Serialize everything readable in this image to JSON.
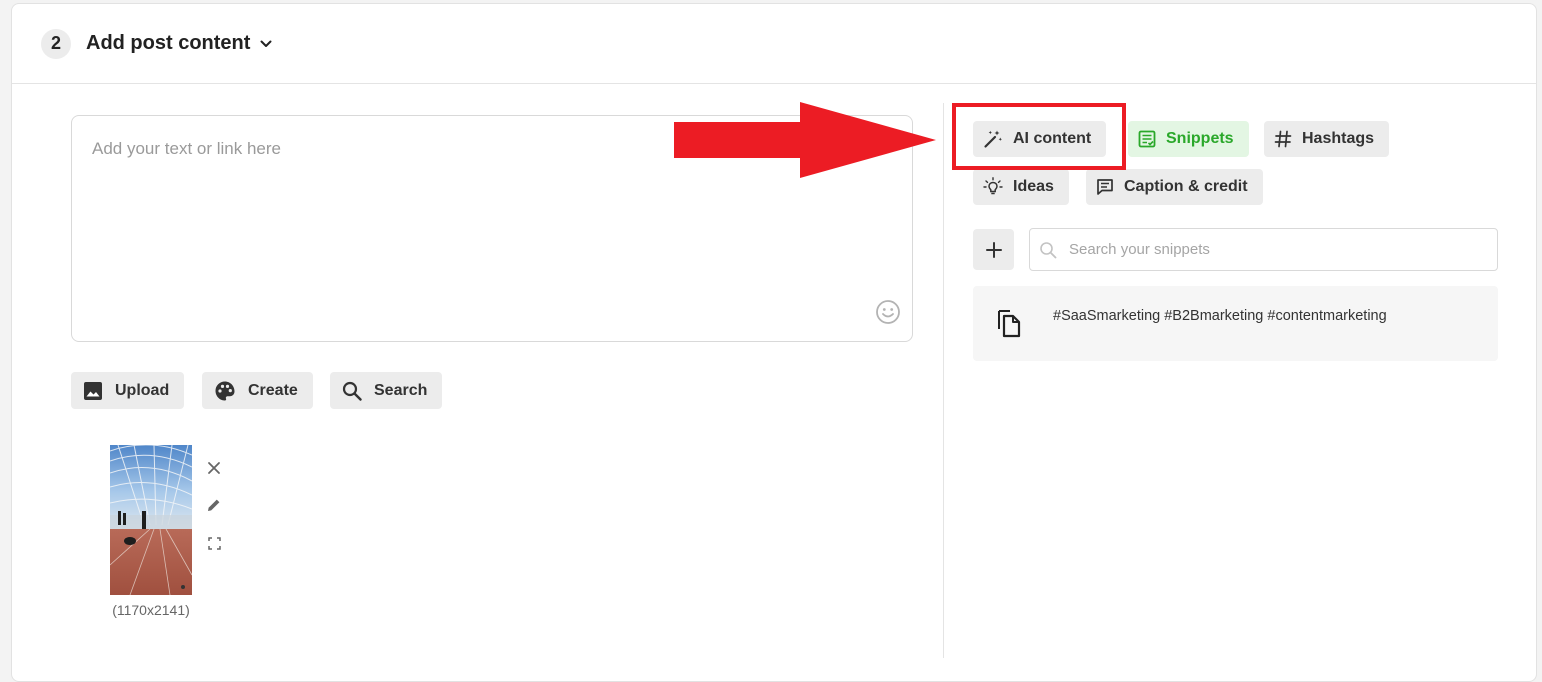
{
  "header": {
    "step_number": "2",
    "title": "Add post content"
  },
  "editor": {
    "placeholder": "Add your text or link here"
  },
  "media_buttons": {
    "upload": "Upload",
    "create": "Create",
    "search": "Search"
  },
  "attachment": {
    "dimensions": "(1170x2141)"
  },
  "tools": {
    "ai_content": "AI content",
    "snippets": "Snippets",
    "hashtags": "Hashtags",
    "ideas": "Ideas",
    "caption_credit": "Caption & credit"
  },
  "snippets_panel": {
    "search_placeholder": "Search your snippets",
    "items": [
      {
        "text": "#SaaSmarketing #B2Bmarketing #contentmarketing"
      }
    ]
  },
  "colors": {
    "annotation_red": "#ec1c24",
    "active_green": "#2aa82a",
    "active_green_bg": "#e3f6e3",
    "button_bg": "#ececec"
  },
  "icons": {
    "header_toggle": "chevron-down-icon",
    "emoji": "smiley-icon",
    "upload": "image-icon",
    "create": "palette-icon",
    "search": "magnifier-icon",
    "remove": "close-icon",
    "edit": "pencil-icon",
    "preview": "fullscreen-icon",
    "ai_content": "magic-wand-icon",
    "snippets": "snippet-note-icon",
    "hashtags": "hashtag-icon",
    "ideas": "lightbulb-icon",
    "caption": "comment-icon",
    "add_snippet": "plus-icon",
    "copy": "copy-icon"
  }
}
